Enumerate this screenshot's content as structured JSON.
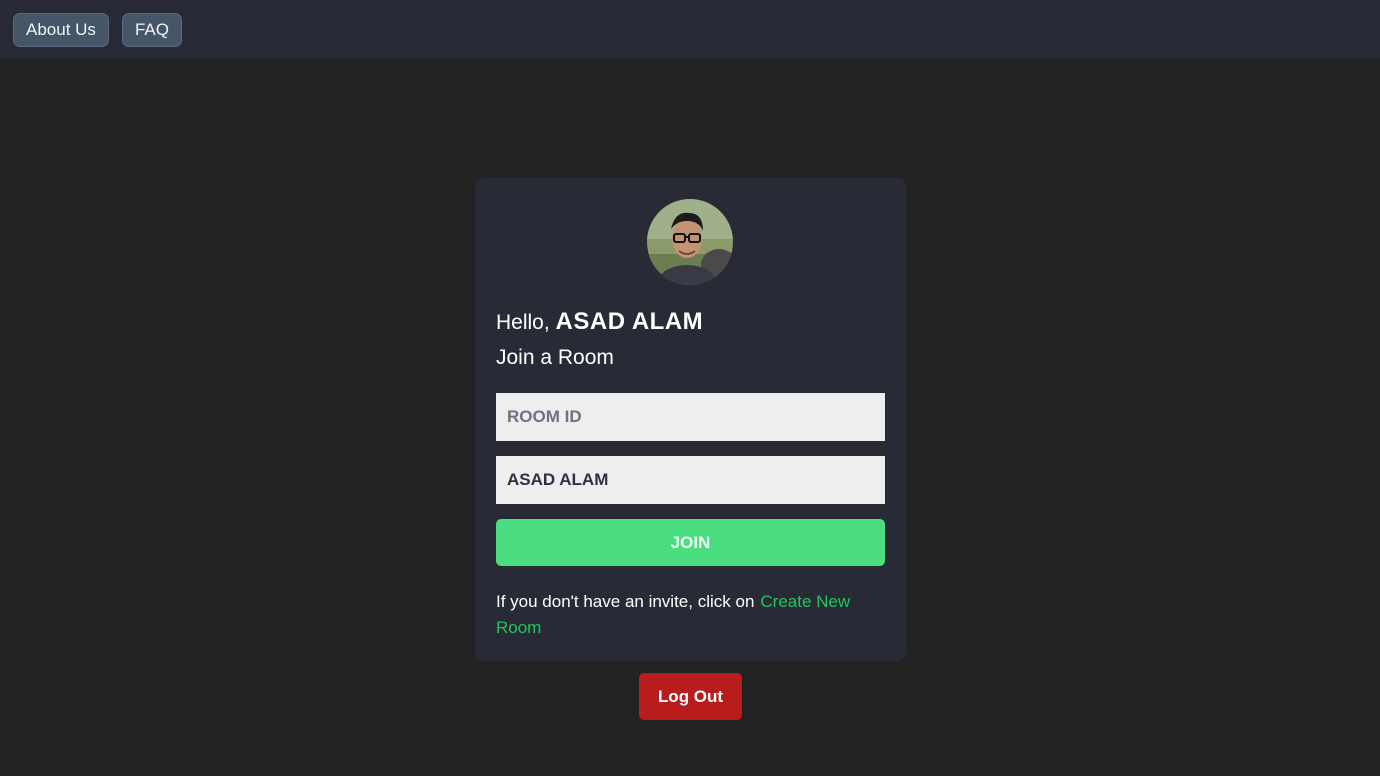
{
  "nav": {
    "about_label": "About Us",
    "faq_label": "FAQ"
  },
  "card": {
    "greeting_prefix": "Hello, ",
    "user_name": "ASAD ALAM",
    "subtitle": "Join a Room",
    "room_id_placeholder": "ROOM ID",
    "room_id_value": "",
    "name_value": "ASAD ALAM",
    "join_label": "JOIN",
    "invite_text": "If you don't have an invite, click on",
    "create_link": "Create New Room"
  },
  "logout_label": "Log Out",
  "colors": {
    "background": "#222222",
    "topbar": "#282a36",
    "card": "#282a36",
    "join": "#4ade80",
    "link": "#22c55e",
    "logout": "#b91c1c"
  }
}
